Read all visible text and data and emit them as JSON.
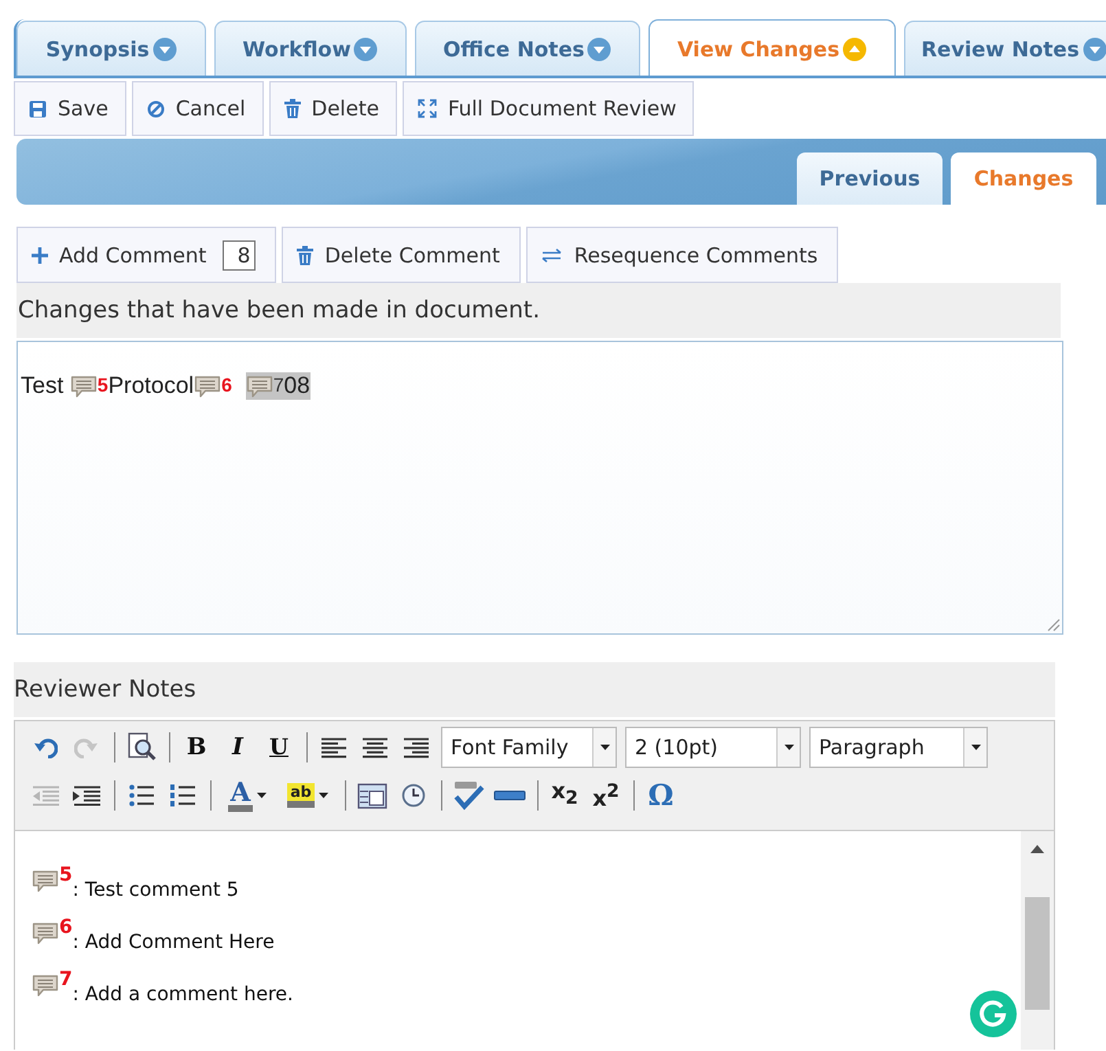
{
  "tabs": [
    {
      "label": "Synopsis",
      "selected": false
    },
    {
      "label": "Workflow",
      "selected": false
    },
    {
      "label": "Office Notes",
      "selected": false
    },
    {
      "label": "View Changes",
      "selected": true
    },
    {
      "label": "Review Notes",
      "selected": false
    }
  ],
  "toolbar": [
    {
      "kind": "save",
      "label": "Save"
    },
    {
      "kind": "cancel",
      "label": "Cancel"
    },
    {
      "kind": "delete",
      "label": "Delete"
    },
    {
      "kind": "expand",
      "label": "Full Document Review"
    }
  ],
  "subtabs": [
    {
      "label": "Previous",
      "selected": false
    },
    {
      "label": "Changes",
      "selected": true
    }
  ],
  "comment_toolbar": [
    {
      "kind": "add",
      "label": "Add Comment",
      "value": "8"
    },
    {
      "kind": "delete",
      "label": "Delete Comment"
    },
    {
      "kind": "resequence",
      "label": "Resequence Comments"
    }
  ],
  "changes": {
    "heading": "Changes that have been made in document.",
    "segments": [
      {
        "kind": "text",
        "text": "Test ",
        "highlighted": false
      },
      {
        "kind": "comment",
        "number": "5",
        "highlighted": false
      },
      {
        "kind": "text",
        "text": "Protocol",
        "highlighted": false
      },
      {
        "kind": "comment",
        "number": "6",
        "highlighted": false
      },
      {
        "kind": "comment",
        "number": "7",
        "highlighted": true
      },
      {
        "kind": "text",
        "text": "08",
        "highlighted": true
      }
    ]
  },
  "reviewer_notes": {
    "heading": "Reviewer Notes",
    "toolbar_rows": [
      [
        {
          "kind": "undo",
          "disabled": false
        },
        {
          "kind": "redo",
          "disabled": true
        },
        {
          "kind": "separator"
        },
        {
          "kind": "preview",
          "disabled": false
        },
        {
          "kind": "separator"
        },
        {
          "kind": "bold",
          "label": "B",
          "disabled": false
        },
        {
          "kind": "italic",
          "label": "I",
          "disabled": false
        },
        {
          "kind": "underline",
          "label": "U",
          "disabled": false
        },
        {
          "kind": "separator"
        },
        {
          "kind": "align-left",
          "disabled": false
        },
        {
          "kind": "align-center",
          "disabled": false
        },
        {
          "kind": "align-right",
          "disabled": false
        },
        {
          "kind": "select",
          "value": "Font Family",
          "disabled": false
        },
        {
          "kind": "select",
          "value": "2 (10pt)",
          "disabled": false
        },
        {
          "kind": "select",
          "value": "Paragraph",
          "disabled": false
        }
      ],
      [
        {
          "kind": "outdent",
          "disabled": true
        },
        {
          "kind": "indent",
          "disabled": false
        },
        {
          "kind": "separator"
        },
        {
          "kind": "bullets",
          "disabled": false
        },
        {
          "kind": "numbers",
          "disabled": false
        },
        {
          "kind": "separator"
        },
        {
          "kind": "font-color",
          "label": "A",
          "disabled": false
        },
        {
          "kind": "highlight",
          "label": "ab",
          "disabled": false
        },
        {
          "kind": "separator"
        },
        {
          "kind": "date",
          "disabled": false
        },
        {
          "kind": "time",
          "disabled": false
        },
        {
          "kind": "separator"
        },
        {
          "kind": "spellcheck",
          "disabled": false
        },
        {
          "kind": "rule",
          "disabled": false
        },
        {
          "kind": "separator"
        },
        {
          "kind": "subscript",
          "label": "x$_{2}$",
          "disabled": false
        },
        {
          "kind": "superscript",
          "label": "x$^{2}$",
          "disabled": false
        },
        {
          "kind": "separator"
        },
        {
          "kind": "symbol",
          "label": "Ω",
          "disabled": false
        }
      ]
    ],
    "comments": [
      {
        "number": "5",
        "text": ": Test comment 5"
      },
      {
        "number": "6",
        "text": ": Add Comment Here"
      },
      {
        "number": "7",
        "text": ": Add a comment here."
      }
    ]
  }
}
